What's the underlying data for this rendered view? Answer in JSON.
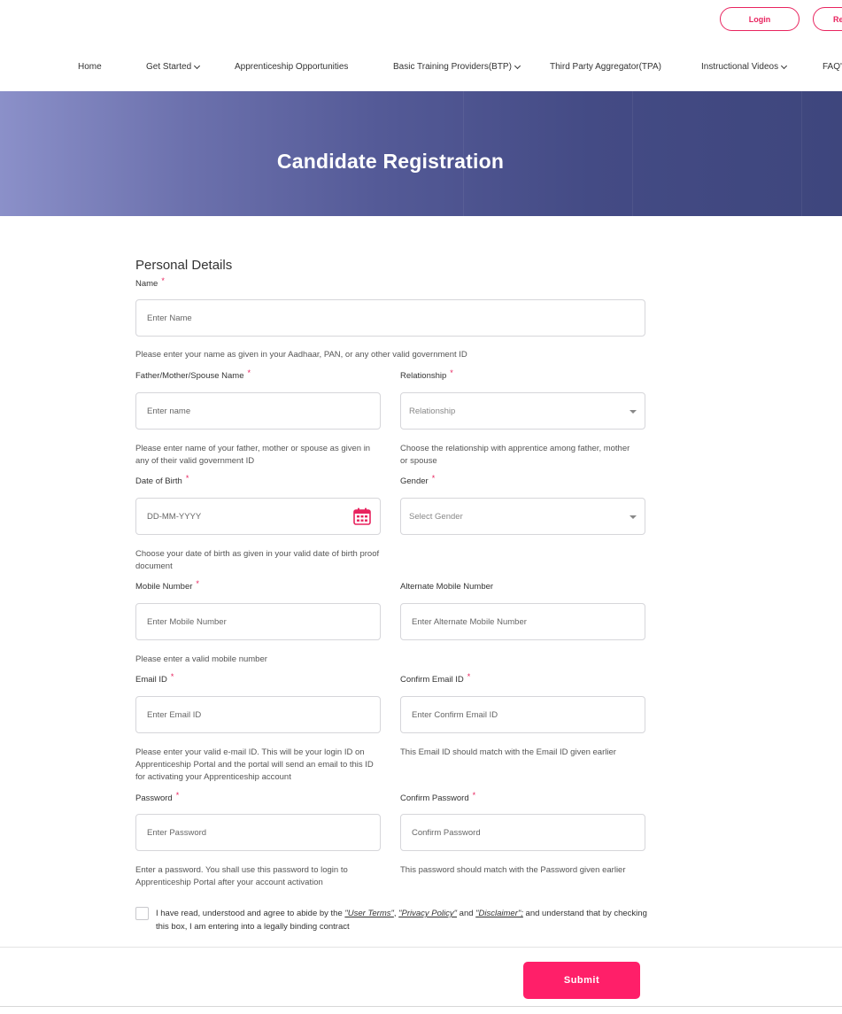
{
  "header": {
    "login_label": "Login",
    "register_label": "Re"
  },
  "nav": {
    "items": [
      {
        "label": "Home"
      },
      {
        "label": "Get Started"
      },
      {
        "label": "Apprenticeship Opportunities"
      },
      {
        "label": "Basic Training Providers(BTP)"
      },
      {
        "label": "Third Party Aggregator(TPA)"
      },
      {
        "label": "Instructional Videos"
      },
      {
        "label": "FAQ's"
      }
    ]
  },
  "banner": {
    "title": "Candidate Registration"
  },
  "form": {
    "section_title": "Personal Details",
    "required_mark": "*",
    "name": {
      "label": "Name",
      "placeholder": "Enter Name",
      "help": "Please enter your name as given in your Aadhaar, PAN, or any other valid government ID"
    },
    "guardian": {
      "label": "Father/Mother/Spouse Name",
      "placeholder": "Enter name",
      "help": "Please enter name of your father, mother or spouse as given in any of their valid government ID"
    },
    "relationship": {
      "label": "Relationship",
      "value": "Relationship",
      "help": "Choose the relationship with apprentice among father, mother or spouse"
    },
    "dob": {
      "label": "Date of Birth",
      "placeholder": "DD-MM-YYYY",
      "help": "Choose your date of birth as given in your valid date of birth proof document"
    },
    "gender": {
      "label": "Gender",
      "value": "Select Gender"
    },
    "mobile": {
      "label": "Mobile Number",
      "placeholder": "Enter Mobile Number",
      "help": "Please enter a valid mobile number"
    },
    "alt_mobile": {
      "label": "Alternate Mobile Number",
      "placeholder": "Enter Alternate Mobile Number"
    },
    "email": {
      "label": "Email ID",
      "placeholder": "Enter Email ID",
      "help": "Please enter your valid e-mail ID. This will be your login ID on Apprenticeship Portal and the portal will send an email to this ID for activating your Apprenticeship account"
    },
    "confirm_email": {
      "label": "Confirm Email ID",
      "placeholder": "Enter Confirm Email ID",
      "help": "This Email ID should match with the Email ID given earlier"
    },
    "password": {
      "label": "Password",
      "placeholder": "Enter Password",
      "help": "Enter a password. You shall use this password to login to Apprenticeship Portal after your account activation"
    },
    "confirm_password": {
      "label": "Confirm Password",
      "placeholder": "Confirm Password",
      "help": "This password should match with the Password given earlier"
    },
    "consent": {
      "prefix": "I have read, understood and agree to abide by the ",
      "user_terms": "\"User Terms\"",
      "sep1": ", ",
      "privacy_policy": "\"Privacy Policy\"",
      "sep2": " and ",
      "disclaimer": "\"Disclaimer\";",
      "suffix": " and understand that by checking this box, I am entering into a legally binding contract"
    },
    "submit_label": "Submit"
  },
  "colors": {
    "accent": "#ff1f69",
    "banner_start": "#8b90c9",
    "banner_end": "#3e467d"
  }
}
